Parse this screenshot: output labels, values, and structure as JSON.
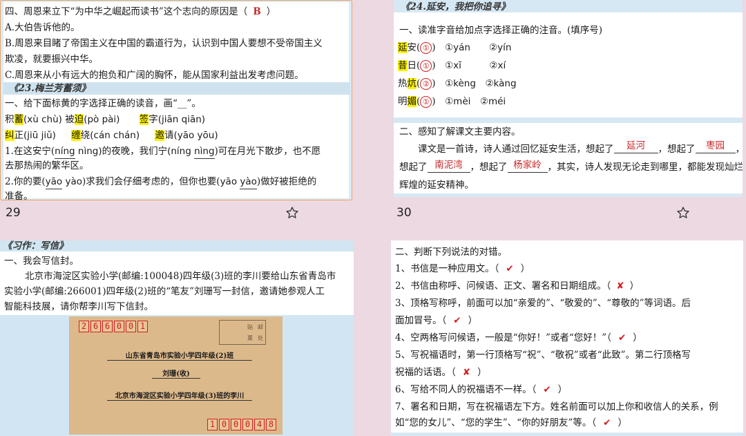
{
  "slide1": {
    "q4": "四、周恩来立下“为中华之崛起而读书”这个志向的原因是（",
    "q4_answer": "B",
    "q4_close": "）",
    "optA": "A.大伯告诉他的。",
    "optB1": "B.周恩来目睹了帝国主义在中国的霸道行为，认识到中国人要想不受帝国主义",
    "optB2": "欺凌，就要振兴中华。",
    "optC": "C.周恩来从小有远大的抱负和广阔的胸怀，能从国家利益出发考虑问题。",
    "lesson": "《23.梅兰芳蓄须》",
    "s1": "一、给下面标黄的字选择正确的读音，画“",
    "s1_blank": "__",
    "s1_end": "”。",
    "r1": {
      "a_pre": "积",
      "a_hl": "蓄",
      "a_py": "(xù  chù)",
      "b_pre": "被",
      "b_hl": "迫",
      "b_py": "(pò  pài)",
      "c_hl": "签",
      "c_post": "字",
      "c_py": "(jiān  qiān)"
    },
    "r2": {
      "a_hl": "纠",
      "a_post": "正",
      "a_py": "(jiū  jiǔ)",
      "b_hl": "缠",
      "b_post": "绕",
      "b_py": "(cán  chán)",
      "c_hl": "邀",
      "c_post": "请",
      "c_py": "(yāo  yōu)"
    },
    "p1a": "1.在这安宁(",
    "p1b": "níng",
    "p1c": "nìng)的夜晚，我们宁(",
    "p1d": "níng",
    "p1e": "nìng",
    "p1f": ")可在月光下散步，也不愿",
    "p1g": "去那热闹的繁华区。",
    "p2a": "2.你的要(",
    "p2b": "yāo",
    "p2c": "yào",
    "p2d": ")求我们会仔细考虑的，但你也要(",
    "p2e": "yāo",
    "p2f": "yào",
    "p2g": ")做好被拒绝的",
    "p2h": "准备。",
    "page": "29"
  },
  "slide2": {
    "lesson": "《24.延安，我把你追寻》",
    "s1": "一、读准字音给加点字选择正确的注音。(填序号)",
    "rows": [
      {
        "hl": "延",
        "post": "安",
        "pre": "",
        "ans": "①",
        "o1": "①yán",
        "o2": "②yín"
      },
      {
        "hl": "昔",
        "post": "日",
        "pre": "",
        "ans": "①",
        "o1": "①xī",
        "o2": "②xí"
      },
      {
        "hl": "炕",
        "post": "",
        "pre": "热",
        "ans": "②",
        "o1": "①kèng",
        "o2": "②kàng"
      },
      {
        "hl": "媚",
        "post": "",
        "pre": "明",
        "ans": "①",
        "o1": "①mèi",
        "o2": "②méi"
      }
    ],
    "s2": "二、感知了解课文主要内容。",
    "p_a": "课文是一首诗，诗人通过回忆延安生活，想起了",
    "p_b": "延河",
    "p_c": "，想起了",
    "p_d": "枣园",
    "p_e": "，",
    "p_f": "想起了",
    "p_g": "南泥湾",
    "p_h": "，想起了",
    "p_i": "杨家岭",
    "p_j": "，其实，诗人发现无论走到哪里，都能发现灿烂",
    "p_k": "辉煌的延安精神。",
    "page": "30"
  },
  "slide3": {
    "lesson": "《习作：写信》",
    "s1": "一、我会写信封。",
    "p1": "北京市海淀区实验小学(邮编:100048)四年级(3)班的李川要给山东省青岛市",
    "p2": "实验小学(邮编:266001)四年级(2)班的“笔友”刘珊写一封信，邀请她参观人工",
    "p3": "智能科技展，请你帮李川写下信封。",
    "to_zip": [
      "2",
      "6",
      "6",
      "0",
      "0",
      "1"
    ],
    "stamp_a": "贴",
    "stamp_b": "邮",
    "stamp_c": "票",
    "stamp_d": "处",
    "to_addr": "山东省青岛市实验小学四年级(2)班",
    "to_name": "刘珊(收)",
    "from_addr": "北京市海淀区实验小学四年级(3)班的李川",
    "from_zip": [
      "1",
      "0",
      "0",
      "0",
      "4",
      "8"
    ]
  },
  "slide4": {
    "s2": "二、判断下列说法的对错。",
    "items": [
      {
        "t": "1、书信是一种应用文。（",
        "m": "✔",
        "e": "）"
      },
      {
        "t": "2、书信由称呼、问候语、正文、署名和日期组成。（",
        "m": "✘",
        "e": "）"
      },
      {
        "t": "3、顶格写称呼，前面可以加“亲爱的”、“敬爱的”、“尊敬的”等词语。后",
        "m": "",
        "e": ""
      },
      {
        "t": "面加冒号。（",
        "m": "✔",
        "e": "）"
      },
      {
        "t": "4、空两格写问候语，一般是“你好！”或者“您好！”（",
        "m": "✔",
        "e": "）"
      },
      {
        "t": "5、写祝福语时，第一行顶格写“祝”、“敬祝”或者“此致”。第二行顶格写",
        "m": "",
        "e": ""
      },
      {
        "t": "祝福的话语。（",
        "m": "✘",
        "e": "）"
      },
      {
        "t": "6、写给不同人的祝福语不一样。（",
        "m": "✔",
        "e": "）"
      },
      {
        "t": "7、署名和日期，写在祝福语左下方。姓名前面可以加上你和收信人的关系，例",
        "m": "",
        "e": ""
      },
      {
        "t": "如“您的女儿”、“您的学生”、“你的好朋友”等。（",
        "m": "✔",
        "e": "）"
      }
    ]
  },
  "icons": {
    "star": "star-outline-icon"
  }
}
